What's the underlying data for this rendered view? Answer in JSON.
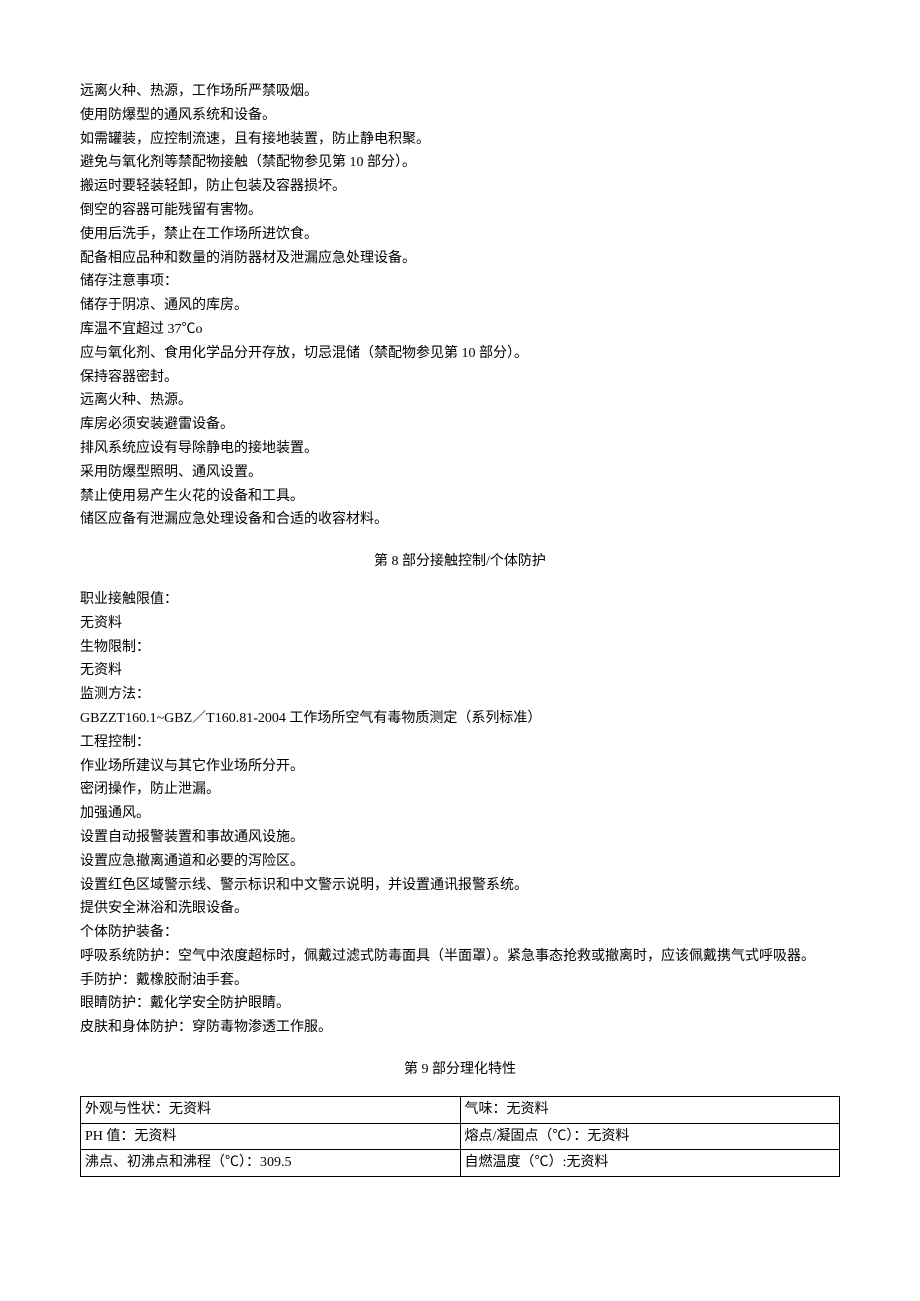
{
  "section7": {
    "lines": [
      "远离火种、热源，工作场所严禁吸烟。",
      "使用防爆型的通风系统和设备。",
      "如需罐装，应控制流速，且有接地装置，防止静电积聚。",
      "避免与氧化剂等禁配物接触（禁配物参见第 10 部分）。",
      "搬运时要轻装轻卸，防止包装及容器损坏。",
      "倒空的容器可能残留有害物。",
      "使用后洗手，禁止在工作场所进饮食。",
      "配备相应品种和数量的消防器材及泄漏应急处理设备。",
      "储存注意事项：",
      "储存于阴凉、通风的库房。",
      "库温不宜超过 37℃o",
      "应与氧化剂、食用化学品分开存放，切忌混储（禁配物参见第 10 部分）。",
      "保持容器密封。",
      "远离火种、热源。",
      "库房必须安装避雷设备。",
      "排风系统应设有导除静电的接地装置。",
      "采用防爆型照明、通风设置。",
      "禁止使用易产生火花的设备和工具。",
      "储区应备有泄漏应急处理设备和合适的收容材料。"
    ]
  },
  "section8": {
    "header": "第 8 部分接触控制/个体防护",
    "lines": [
      "职业接触限值：",
      "无资料",
      "生物限制：",
      "无资料",
      "监测方法：",
      "GBZZT160.1~GBZ／T160.81-2004 工作场所空气有毒物质测定（系列标准）",
      "工程控制：",
      "作业场所建议与其它作业场所分开。",
      "密闭操作，防止泄漏。",
      "加强通风。",
      "设置自动报警装置和事故通风设施。",
      "设置应急撤离通道和必要的泻险区。",
      "设置红色区域警示线、警示标识和中文警示说明，并设置通讯报警系统。",
      "提供安全淋浴和洗眼设备。",
      "个体防护装备：",
      "呼吸系统防护：空气中浓度超标时，佩戴过滤式防毒面具（半面罩）。紧急事态抢救或撤离时，应该佩戴携气式呼吸器。",
      "手防护：戴橡胶耐油手套。",
      "眼睛防护：戴化学安全防护眼睛。",
      "皮肤和身体防护：穿防毒物渗透工作服。"
    ]
  },
  "section9": {
    "header": "第 9 部分理化特性",
    "rows": [
      {
        "left": "外观与性状：无资料",
        "right": "气味：无资料"
      },
      {
        "left": "PH 值：无资料",
        "right": "熔点/凝固点（℃）：无资料"
      },
      {
        "left": "沸点、初沸点和沸程（℃）：309.5",
        "right": "自燃温度（℃）:无资料"
      }
    ]
  }
}
